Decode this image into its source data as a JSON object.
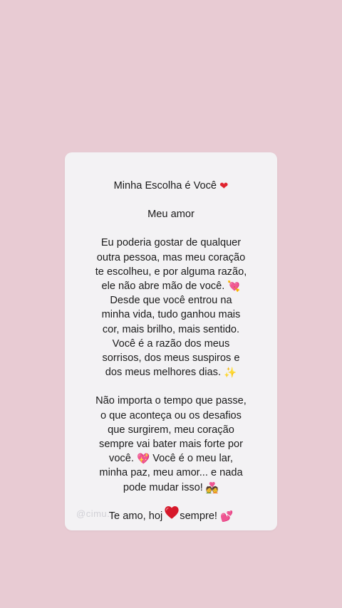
{
  "card": {
    "title": "Minha Escolha é Você",
    "greeting": "Meu amor",
    "para1": [
      "Eu poderia gostar de qualquer",
      "outra pessoa, mas meu coração",
      "te escolheu, e por alguma razão,",
      "ele não abre mão de você.",
      "Desde que você entrou na",
      "minha vida, tudo ganhou mais",
      "cor, mais brilho, mais sentido.",
      "Você é a razão dos meus",
      "sorrisos, dos meus suspiros e",
      "dos meus melhores dias."
    ],
    "para2": [
      "Não importa o tempo que passe,",
      "o que aconteça ou os desafios",
      "que surgirem, meu coração",
      "sempre vai bater mais forte por",
      "você.",
      "Você é o meu lar,",
      "minha paz, meu amor... e nada",
      "pode mudar isso!"
    ],
    "closing_a": "Te amo, hoj",
    "closing_b": " sempre!",
    "watermark": "@cimu..."
  },
  "icons": {
    "title_heart": "red-heart-icon",
    "heart_arrow": "heart-with-arrow-icon",
    "sparkles": "sparkles-icon",
    "sparkling_heart": "sparkling-heart-icon",
    "couple": "couple-with-heart-icon",
    "two_hearts": "two-hearts-icon",
    "overlay_heart": "red-heart-icon"
  },
  "colors": {
    "background": "#e8cbd3",
    "card": "#f3f2f4",
    "text": "#1a1a1a",
    "heart_red": "#e0242f",
    "heart_pink": "#e64e8a"
  }
}
